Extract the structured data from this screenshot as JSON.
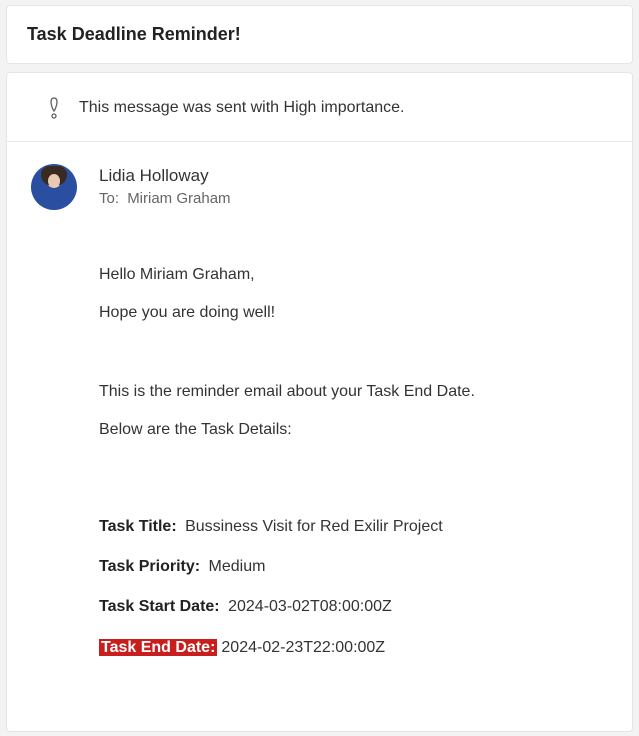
{
  "subject": "Task Deadline Reminder!",
  "importance": {
    "text": "This message was sent with High importance."
  },
  "sender": {
    "name": "Lidia Holloway"
  },
  "recipient": {
    "to_label": "To:",
    "name": "Miriam Graham"
  },
  "body": {
    "greeting": "Hello Miriam Graham,",
    "line2": "Hope you are doing well!",
    "line3": "This is the reminder email about your Task End Date.",
    "line4": "Below are the Task Details:",
    "task_title_label": "Task Title:",
    "task_title_value": "Bussiness Visit for Red Exilir Project",
    "task_priority_label": "Task Priority:",
    "task_priority_value": "Medium",
    "task_start_label": "Task Start Date:",
    "task_start_value": "2024-03-02T08:00:00Z",
    "task_end_label": "Task End Date:",
    "task_end_value": "2024-02-23T22:00:00Z"
  }
}
